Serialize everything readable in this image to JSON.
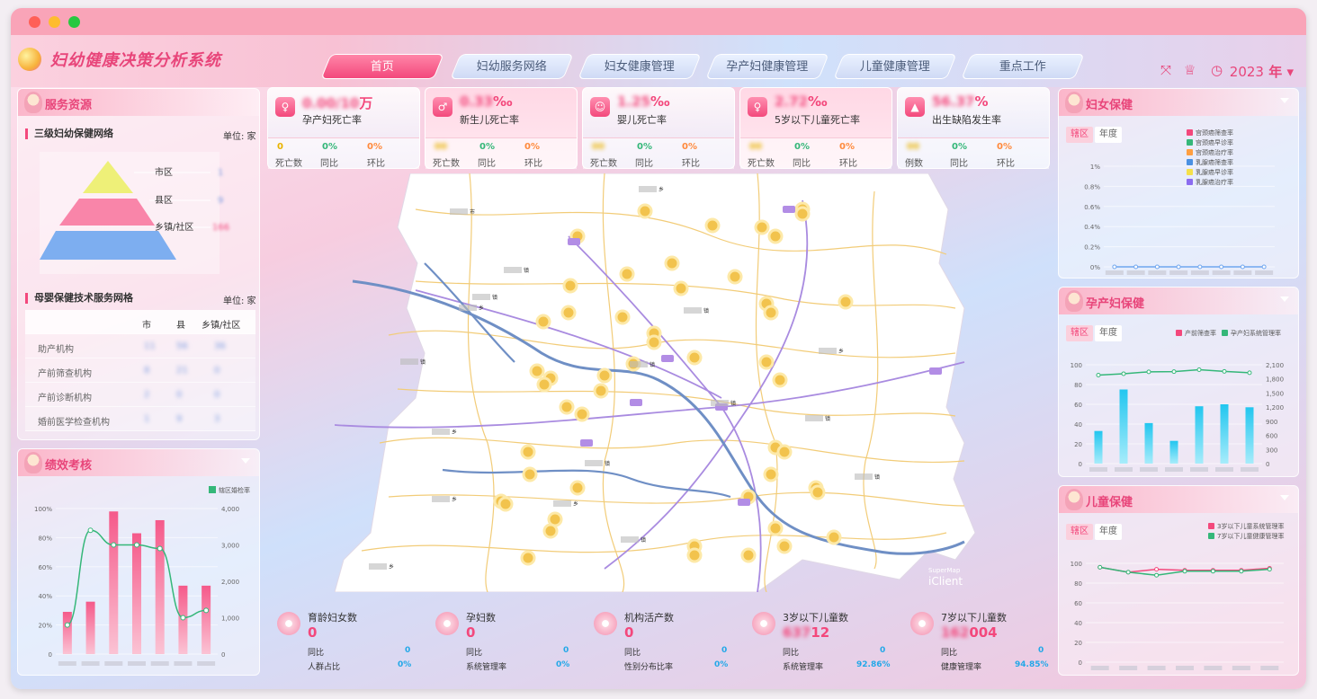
{
  "window": {
    "dots": [
      "#ff5f57",
      "#febc2e",
      "#28c840"
    ]
  },
  "header": {
    "title": "妇幼健康决策分析系统",
    "tabs": [
      {
        "label": "首页",
        "active": true
      },
      {
        "label": "妇幼服务网络"
      },
      {
        "label": "妇女健康管理"
      },
      {
        "label": "孕产妇健康管理"
      },
      {
        "label": "儿童健康管理"
      },
      {
        "label": "重点工作"
      }
    ],
    "year": "2023",
    "year_unit": "年"
  },
  "service": {
    "title": "服务资源",
    "net_title": "三级妇幼保健网络",
    "unit": "单位: 家",
    "levels": [
      {
        "label": "市区",
        "value": "1"
      },
      {
        "label": "县区",
        "value": "9"
      },
      {
        "label": "乡镇/社区",
        "value": "166"
      }
    ],
    "tech_title": "母婴保健技术服务网格",
    "tech_unit": "单位: 家",
    "cols": [
      "市",
      "县",
      "乡镇/社区"
    ],
    "rows": [
      {
        "name": "助产机构",
        "v": [
          "11",
          "56",
          "36"
        ]
      },
      {
        "name": "产前筛查机构",
        "v": [
          "8",
          "21",
          "0"
        ]
      },
      {
        "name": "产前诊断机构",
        "v": [
          "2",
          "0",
          "0"
        ]
      },
      {
        "name": "婚前医学检查机构",
        "v": [
          "1",
          "9",
          "3"
        ]
      }
    ]
  },
  "perf": {
    "title": "绩效考核",
    "legend": "辖区婚检率"
  },
  "kpis": [
    {
      "value": "0.00/10",
      "unit": "万",
      "label": "孕产妇死亡率",
      "a": "0",
      "b": "0%",
      "c": "0%",
      "al": "死亡数",
      "bl": "同比",
      "cl": "环比",
      "icon": "♀"
    },
    {
      "value": "0.33",
      "unit": "‰",
      "label": "新生儿死亡率",
      "a": "00",
      "b": "0%",
      "c": "0%",
      "al": "死亡数",
      "bl": "同比",
      "cl": "环比",
      "icon": "♂"
    },
    {
      "value": "1.25",
      "unit": "‰",
      "label": "婴儿死亡率",
      "a": "00",
      "b": "0%",
      "c": "0%",
      "al": "死亡数",
      "bl": "同比",
      "cl": "环比",
      "icon": "☺"
    },
    {
      "value": "2.72",
      "unit": "‰",
      "label": "5岁以下儿童死亡率",
      "a": "00",
      "b": "0%",
      "c": "0%",
      "al": "死亡数",
      "bl": "同比",
      "cl": "环比",
      "icon": "♀"
    },
    {
      "value": "56.37",
      "unit": "%",
      "label": "出生缺陷发生率",
      "a": "00",
      "b": "0%",
      "c": "0%",
      "al": "例数",
      "bl": "同比",
      "cl": "环比",
      "icon": "▲"
    }
  ],
  "stats": [
    {
      "title": "育龄妇女数",
      "value": "0",
      "r1": "同比",
      "r1v": "0",
      "r2": "人群占比",
      "r2v": "0%"
    },
    {
      "title": "孕妇数",
      "value": "0",
      "r1": "同比",
      "r1v": "0",
      "r2": "系统管理率",
      "r2v": "0%"
    },
    {
      "title": "机构活产数",
      "value": "0",
      "r1": "同比",
      "r1v": "0",
      "r2": "性别分布比率",
      "r2v": "0%"
    },
    {
      "title": "3岁以下儿童数",
      "value": "12",
      "value_blur": "637",
      "r1": "同比",
      "r1v": "0",
      "r2": "系统管理率",
      "r2v": "92.86%"
    },
    {
      "title": "7岁以下儿童数",
      "value": "004",
      "value_blur": "162",
      "r1": "同比",
      "r1v": "0",
      "r2": "健康管理率",
      "r2v": "94.85%"
    }
  ],
  "women": {
    "title": "妇女保健",
    "seg": [
      "辖区",
      "年度"
    ],
    "legend": [
      "宫颈癌筛查率",
      "宫颈癌早诊率",
      "宫颈癌治疗率",
      "乳腺癌筛查率",
      "乳腺癌早诊率",
      "乳腺癌治疗率"
    ],
    "legend_colors": [
      "#f3487c",
      "#35b779",
      "#ff9f40",
      "#4a90e2",
      "#f5e04a",
      "#8b6cf0"
    ]
  },
  "maternal": {
    "title": "孕产妇保健",
    "seg": [
      "辖区",
      "年度"
    ],
    "legend": [
      "产前筛查率",
      "孕产妇系统管理率"
    ],
    "legend_colors": [
      "#f3487c",
      "#35b779"
    ]
  },
  "child": {
    "title": "儿童保健",
    "seg": [
      "辖区",
      "年度"
    ],
    "legend": [
      "3岁以下儿童系统管理率",
      "7岁以下儿童健康管理率"
    ],
    "legend_colors": [
      "#f3487c",
      "#35b779"
    ]
  },
  "map": {
    "brand1": "SuperMap",
    "brand2": "iClient",
    "places": [
      "市",
      "乡",
      "镇",
      "乡",
      "镇",
      "镇",
      "镇",
      "乡",
      "镇",
      "镇",
      "乡",
      "乡",
      "镇",
      "镇",
      "镇",
      "乡",
      "镇",
      "乡"
    ]
  },
  "chart_data": [
    {
      "type": "bar",
      "title": "绩效考核",
      "categories": [
        "",
        "",
        "",
        "",
        "",
        "",
        ""
      ],
      "series": [
        {
          "values": [
            29,
            36,
            98,
            83,
            92,
            47,
            47
          ]
        },
        {
          "name": "辖区婚检率",
          "type": "line",
          "values": [
            800,
            3400,
            3000,
            3000,
            2900,
            1000,
            1200
          ]
        }
      ],
      "ylim": [
        0,
        100
      ],
      "y2lim": [
        0,
        4000
      ],
      "yticks": [
        "0",
        "20%",
        "40%",
        "60%",
        "80%",
        "100%"
      ],
      "y2ticks": [
        "0",
        "1,000",
        "2,000",
        "3,000",
        "4,000"
      ]
    },
    {
      "type": "line",
      "title": "妇女保健",
      "categories": [
        "",
        "",
        "",
        "",
        "",
        "",
        "",
        ""
      ],
      "series": [
        {
          "values": [
            0,
            0,
            0,
            0,
            0,
            0,
            0,
            0
          ]
        }
      ],
      "ylim": [
        0,
        1
      ],
      "yticks": [
        "0%",
        "0.2%",
        "0.4%",
        "0.6%",
        "0.8%",
        "1%"
      ]
    },
    {
      "type": "bar",
      "title": "孕产妇保健",
      "categories": [
        "",
        "",
        "",
        "",
        "",
        "",
        ""
      ],
      "series": [
        {
          "name": "产前筛查率",
          "values": [
            33,
            75,
            41,
            23,
            58,
            60,
            57
          ]
        },
        {
          "name": "孕产妇系统管理率",
          "type": "line",
          "values": [
            1880,
            1910,
            1950,
            1955,
            1995,
            1960,
            1930
          ]
        }
      ],
      "ylim": [
        0,
        100
      ],
      "y2lim": [
        0,
        2100
      ],
      "yticks": [
        "0",
        "20",
        "40",
        "60",
        "80",
        "100"
      ],
      "y2ticks": [
        "0",
        "300",
        "600",
        "900",
        "1,200",
        "1,500",
        "1,800",
        "2,100"
      ]
    },
    {
      "type": "line",
      "title": "儿童保健",
      "categories": [
        "",
        "",
        "",
        "",
        "",
        "",
        ""
      ],
      "series": [
        {
          "name": "3岁以下儿童系统管理率",
          "values": [
            96,
            91,
            94,
            93,
            93,
            93,
            95
          ]
        },
        {
          "name": "7岁以下儿童健康管理率",
          "values": [
            96,
            91,
            88,
            92,
            92,
            92,
            94
          ]
        }
      ],
      "ylim": [
        0,
        100
      ],
      "yticks": [
        "0",
        "20",
        "40",
        "60",
        "80",
        "100"
      ]
    }
  ]
}
